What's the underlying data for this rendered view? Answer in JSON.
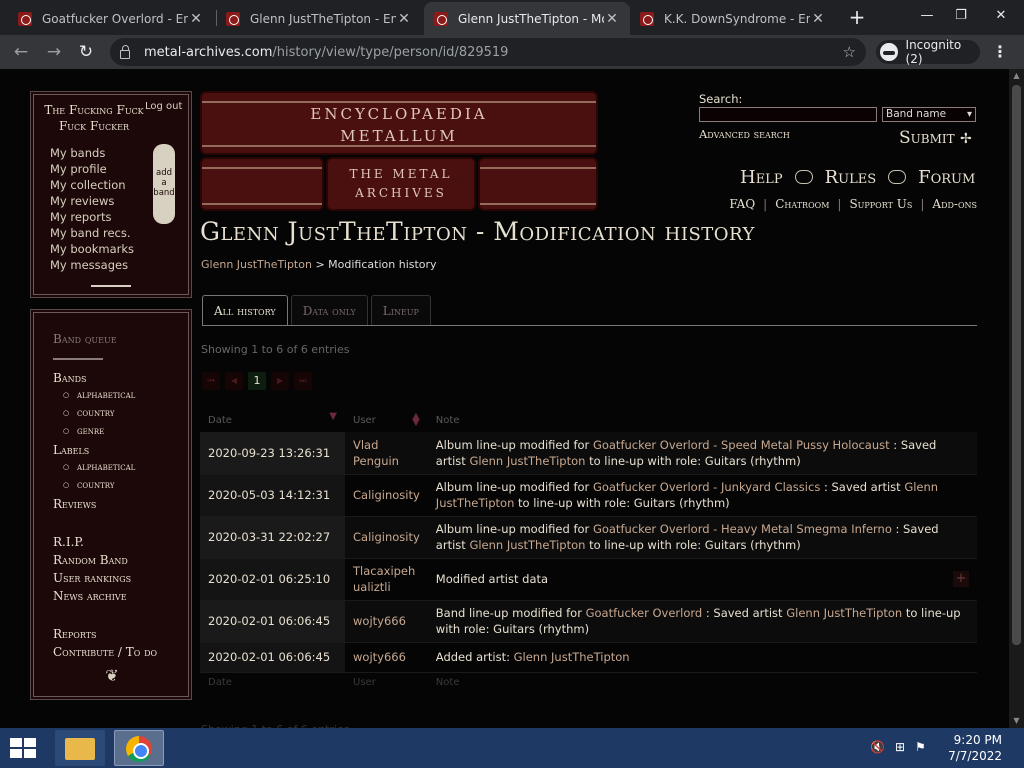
{
  "browser": {
    "tabs": [
      {
        "title": "Goatfucker Overlord - Ency"
      },
      {
        "title": "Glenn JustTheTipton - Ency"
      },
      {
        "title": "Glenn JustTheTipton - Mod"
      },
      {
        "title": "K.K. DownSyndrome - Ency"
      }
    ],
    "url_host": "metal-archives.com",
    "url_path": "/history/view/type/person/id/829519",
    "incognito_label": "Incognito (2)"
  },
  "sidebar": {
    "username": "The Fucking Fuck Fuck Fucker",
    "logout": "Log out",
    "user_links": [
      "My bands",
      "My profile",
      "My collection",
      "My reviews",
      "My reports",
      "My band recs.",
      "My bookmarks",
      "My messages"
    ],
    "add_band": "add a band",
    "nav": {
      "band_queue": "Band queue",
      "bands": "Bands",
      "bands_sub": [
        "alphabetical",
        "country",
        "genre"
      ],
      "labels": "Labels",
      "labels_sub": [
        "alphabetical",
        "country"
      ],
      "reviews": "Reviews",
      "rip": "R.I.P.",
      "random_band": "Random Band",
      "user_rankings": "User rankings",
      "news_archive": "News archive",
      "reports": "Reports",
      "contribute": "Contribute / To do"
    }
  },
  "logo": {
    "line1": "ENCYCLOPAEDIA",
    "line2": "METALLUM",
    "line3": "THE METAL",
    "line4": "ARCHIVES"
  },
  "search": {
    "label": "Search:",
    "value": "",
    "type_selected": "Band name",
    "advanced": "Advanced search",
    "submit": "Submit"
  },
  "mainnav": [
    "Help",
    "Rules",
    "Forum"
  ],
  "secnav": [
    "FAQ",
    "Chatroom",
    "Support Us",
    "Add-ons"
  ],
  "page": {
    "title": "Glenn JustTheTipton - Modification history",
    "crumb_link": "Glenn JustTheTipton",
    "crumb_current": "Modification history",
    "tabs": [
      "All history",
      "Data only",
      "Lineup"
    ],
    "showing": "Showing 1 to 6 of 6 entries",
    "current_page": "1",
    "columns": {
      "date": "Date",
      "user": "User",
      "note": "Note"
    }
  },
  "rows": [
    {
      "date": "2020-09-23 13:26:31",
      "user": "Vlad Penguin",
      "pre": "Album line-up modified for ",
      "link1": "Goatfucker Overlord - Speed Metal Pussy Holocaust",
      "mid": " : Saved artist ",
      "link2": "Glenn JustTheTipton",
      "post": " to line-up with role: Guitars (rhythm)"
    },
    {
      "date": "2020-05-03 14:12:31",
      "user": "Caliginosity",
      "pre": "Album line-up modified for ",
      "link1": "Goatfucker Overlord - Junkyard Classics",
      "mid": " : Saved artist ",
      "link2": "Glenn JustTheTipton",
      "post": " to line-up with role: Guitars (rhythm)"
    },
    {
      "date": "2020-03-31 22:02:27",
      "user": "Caliginosity",
      "pre": "Album line-up modified for ",
      "link1": "Goatfucker Overlord - Heavy Metal Smegma Inferno",
      "mid": " : Saved artist ",
      "link2": "Glenn JustTheTipton",
      "post": " to line-up with role: Guitars (rhythm)"
    },
    {
      "date": "2020-02-01 06:25:10",
      "user": "Tlacaxipehualiztli",
      "pre": "Modified artist data",
      "link1": "",
      "mid": "",
      "link2": "",
      "post": ""
    },
    {
      "date": "2020-02-01 06:06:45",
      "user": "wojty666",
      "pre": "Band line-up modified for ",
      "link1": "Goatfucker Overlord",
      "mid": " : Saved artist ",
      "link2": "Glenn JustTheTipton",
      "post": " to line-up with role: Guitars (rhythm)"
    },
    {
      "date": "2020-02-01 06:06:45",
      "user": "wojty666",
      "pre": "Added artist: ",
      "link1": "Glenn JustTheTipton",
      "mid": "",
      "link2": "",
      "post": ""
    }
  ],
  "taskbar": {
    "time": "9:20 PM",
    "date": "7/7/2022"
  }
}
